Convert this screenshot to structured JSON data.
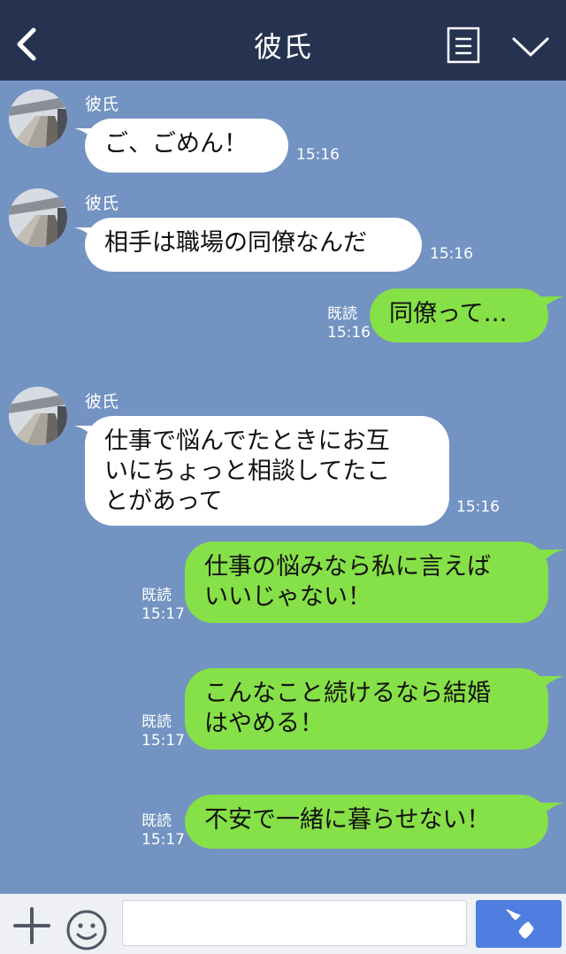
{
  "header": {
    "title": "彼氏"
  },
  "colors": {
    "header_bg": "#263350",
    "chat_bg": "#7393c2",
    "outgoing_bubble": "#86e047",
    "incoming_bubble": "#ffffff",
    "send_button": "#4d7ee0"
  },
  "icons": [
    "back-icon",
    "menu-icon",
    "chevron-down-icon",
    "plus-icon",
    "smile-icon",
    "phone-icon",
    "avatar"
  ],
  "messages": [
    {
      "sender": "彼氏",
      "text": "ご、ごめん！",
      "time": "15:16"
    },
    {
      "sender": "彼氏",
      "text": "相手は職場の同僚なんだ",
      "time": "15:16"
    },
    {
      "read": "既読",
      "text": "同僚って…",
      "time": "15:16"
    },
    {
      "sender": "彼氏",
      "text": "仕事で悩んでたときにお互\nいにちょっと相談してたこ\nとがあって",
      "time": "15:16"
    },
    {
      "read": "既読",
      "text": "仕事の悩みなら私に言えば\nいいじゃない！",
      "time": "15:17"
    },
    {
      "read": "既読",
      "text": "こんなこと続けるなら結婚\nはやめる！",
      "time": "15:17"
    },
    {
      "read": "既読",
      "text": "不安で一緒に暮らせない！",
      "time": "15:17"
    }
  ],
  "footer": {
    "input_placeholder": ""
  }
}
